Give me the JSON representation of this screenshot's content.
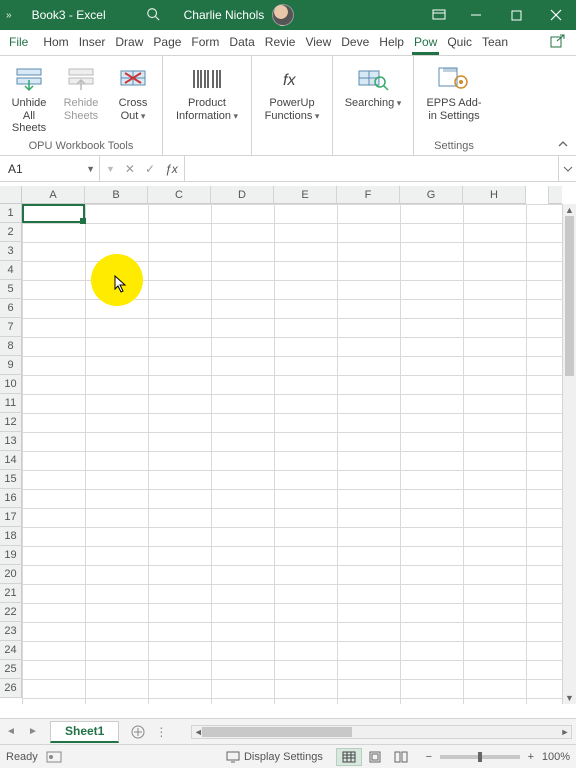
{
  "titlebar": {
    "doc": "Book3",
    "sep": " - ",
    "app": "Excel",
    "user": "Charlie Nichols"
  },
  "tabs": {
    "file": "File",
    "items": [
      "Hom",
      "Inser",
      "Draw",
      "Page",
      "Form",
      "Data",
      "Revie",
      "View",
      "Deve",
      "Help",
      "Pow",
      "Quic",
      "Tean"
    ],
    "active_index": 10
  },
  "ribbon": {
    "btn_unhide_l1": "Unhide",
    "btn_unhide_l2": "All Sheets",
    "btn_rehide_l1": "Rehide",
    "btn_rehide_l2": "Sheets",
    "btn_cross_l1": "Cross",
    "btn_cross_l2": "Out",
    "group_opu": "OPU Workbook Tools",
    "btn_prodinfo_l1": "Product",
    "btn_prodinfo_l2": "Information",
    "btn_powerup_l1": "PowerUp",
    "btn_powerup_l2": "Functions",
    "btn_search_l1": "Searching",
    "btn_epps_l1": "EPPS Add-",
    "btn_epps_l2": "in Settings",
    "group_settings": "Settings"
  },
  "namebox": {
    "ref": "A1"
  },
  "formula": {
    "value": ""
  },
  "columns": [
    "A",
    "B",
    "C",
    "D",
    "E",
    "F",
    "G",
    "H"
  ],
  "rows": [
    "1",
    "2",
    "3",
    "4",
    "5",
    "6",
    "7",
    "8",
    "9",
    "10",
    "11",
    "12",
    "13",
    "14",
    "15",
    "16",
    "17",
    "18",
    "19",
    "20",
    "21",
    "22",
    "23",
    "24",
    "25",
    "26"
  ],
  "sheet": {
    "active": "Sheet1"
  },
  "highlight": {
    "col_index": 1,
    "row_index": 3
  },
  "status": {
    "ready": "Ready",
    "display": "Display Settings",
    "zoom": "100%"
  }
}
